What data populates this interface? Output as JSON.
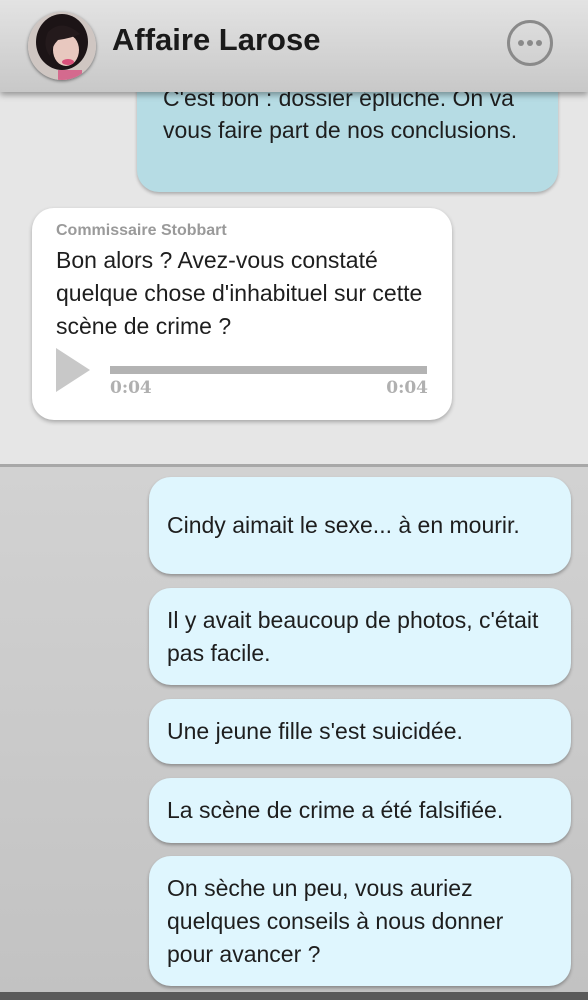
{
  "header": {
    "title": "Affaire Larose",
    "avatar_icon": "profile-avatar",
    "more_icon": "more-options-icon"
  },
  "history": {
    "sent_partial": "C'est bon : dossier épluché. On va vous faire part de nos conclusions.",
    "received": {
      "sender": "Commissaire Stobbart",
      "text": "Bon alors ? Avez-vous constaté quelque chose d'inhabituel sur cette scène de crime ?",
      "audio": {
        "current_time": "0:04",
        "duration": "0:04"
      }
    }
  },
  "options": [
    "Cindy aimait le sexe... à en mourir.",
    "Il y avait beaucoup de photos, c'était pas facile.",
    "Une jeune fille s'est suicidée.",
    "La scène de crime a été falsifiée.",
    "On sèche un peu, vous auriez quelques conseils à nous donner pour avancer ?"
  ],
  "colors": {
    "sent_bubble": "#b6dce4",
    "option_bubble": "#dff6fe",
    "received_bubble": "#ffffff"
  }
}
